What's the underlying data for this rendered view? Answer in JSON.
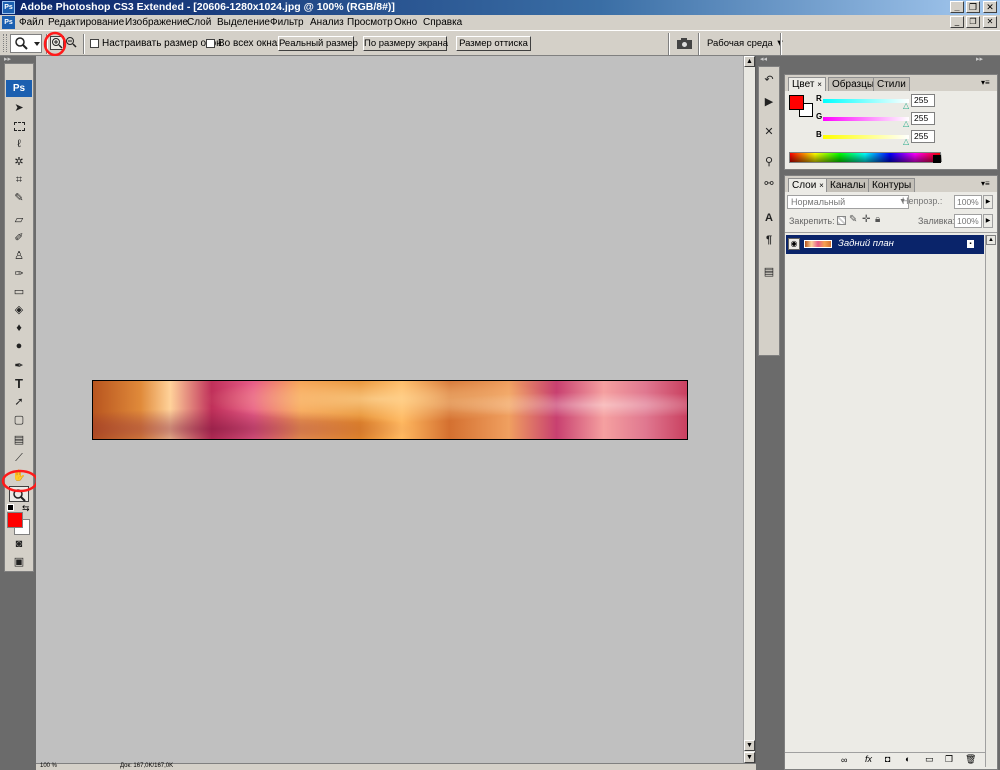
{
  "window": {
    "title": "Adobe Photoshop CS3 Extended - [20606-1280x1024.jpg @ 100% (RGB/8#)]",
    "controls": {
      "minimize": "_",
      "restore": "❐",
      "close": "✕"
    }
  },
  "menu": {
    "items": [
      "Файл",
      "Редактирование",
      "Изображение",
      "Слой",
      "Выделение",
      "Фильтр",
      "Анализ",
      "Просмотр",
      "Окно",
      "Справка"
    ]
  },
  "options": {
    "resize_windows_label": "Настраивать размер окон",
    "all_windows_label": "Во всех окнах",
    "actual_pixels_button": "Реальный размер",
    "fit_screen_button": "По размеру экрана",
    "print_size_button": "Размер оттиска",
    "workspace_label": "Рабочая среда ▼"
  },
  "toolbox": {
    "ps_logo": "Ps"
  },
  "color_panel": {
    "tabs": [
      "Цвет",
      "Образцы",
      "Стили"
    ],
    "channels": [
      {
        "label": "R",
        "value": "255",
        "gradient": "#00ffff,#ff0000"
      },
      {
        "label": "G",
        "value": "255",
        "gradient": "#ff0000,#ffff00"
      },
      {
        "label": "B",
        "value": "255",
        "gradient": "#ff0000,#ff00ff"
      }
    ],
    "foreground": "#ff0000",
    "background": "#ffffff"
  },
  "layers_panel": {
    "tabs": [
      "Слои",
      "Каналы",
      "Контуры"
    ],
    "blend_mode": "Нормальный",
    "opacity_label": "Непрозр.:",
    "opacity_value": "100%",
    "lock_label": "Закрепить:",
    "fill_label": "Заливка:",
    "fill_value": "100%",
    "layer_name": "Задний план"
  },
  "status": {
    "zoom": "100 %",
    "doc_info": "Док: 167,0K/167,0K"
  },
  "colors": {
    "accent_red": "#ff0000",
    "layer_selected": "#0a246a",
    "canvas_gray": "#c0c0c0"
  }
}
